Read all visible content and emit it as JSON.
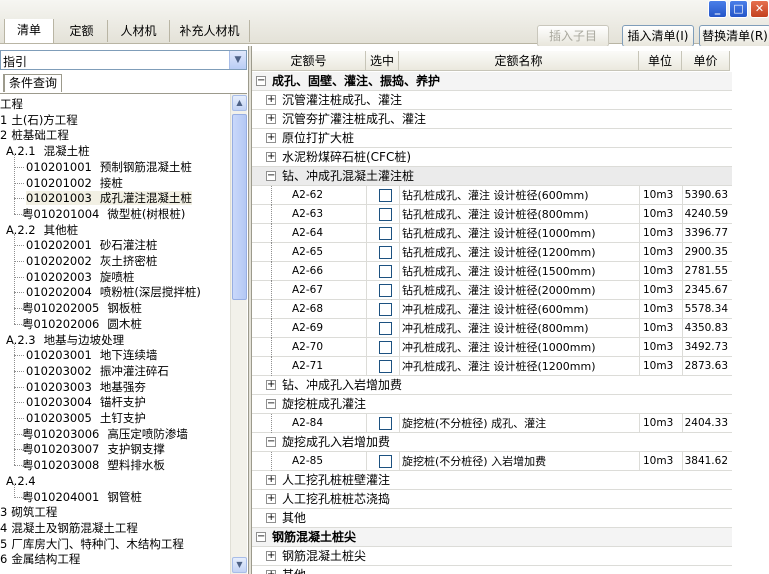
{
  "window": {
    "minimize": "_",
    "maximize": "□",
    "close": "✕"
  },
  "tabs": [
    {
      "label": "清单"
    },
    {
      "label": "定额"
    },
    {
      "label": "人材机"
    },
    {
      "label": "补充人材机"
    }
  ],
  "toolbar": {
    "insert_child": "插入子目",
    "insert_list": "插入清单(I)",
    "replace_list": "替换清单(R)"
  },
  "left": {
    "combo_value": "指引",
    "search_tab": "条件查询",
    "tree": [
      {
        "code": "工程",
        "name": ""
      },
      {
        "code": "1",
        "name": "土(石)方工程"
      },
      {
        "code": "2",
        "name": "桩基础工程"
      },
      {
        "code": "A.2.1",
        "name": "混凝土桩"
      },
      {
        "code": "010201001",
        "name": "预制钢筋混凝土桩"
      },
      {
        "code": "010201002",
        "name": "接桩"
      },
      {
        "code": "010201003",
        "name": "成孔灌注混凝土桩"
      },
      {
        "code": "粤010201004",
        "name": "微型桩(树根桩)"
      },
      {
        "code": "A.2.2",
        "name": "其他桩"
      },
      {
        "code": "010202001",
        "name": "砂石灌注桩"
      },
      {
        "code": "010202002",
        "name": "灰土挤密桩"
      },
      {
        "code": "010202003",
        "name": "旋喷桩"
      },
      {
        "code": "010202004",
        "name": "喷粉桩(深层搅拌桩)"
      },
      {
        "code": "粤010202005",
        "name": "钢板桩"
      },
      {
        "code": "粤010202006",
        "name": "圆木桩"
      },
      {
        "code": "A.2.3",
        "name": "地基与边坡处理"
      },
      {
        "code": "010203001",
        "name": "地下连续墙"
      },
      {
        "code": "010203002",
        "name": "振冲灌注碎石"
      },
      {
        "code": "010203003",
        "name": "地基强夯"
      },
      {
        "code": "010203004",
        "name": "锚杆支护"
      },
      {
        "code": "010203005",
        "name": "土钉支护"
      },
      {
        "code": "粤010203006",
        "name": "高压定喷防渗墙"
      },
      {
        "code": "粤010203007",
        "name": "支护钢支撑"
      },
      {
        "code": "粤010203008",
        "name": "塑料排水板"
      },
      {
        "code": "A.2.4",
        "name": ""
      },
      {
        "code": "粤010204001",
        "name": "钢管桩"
      },
      {
        "code": "3",
        "name": "砌筑工程"
      },
      {
        "code": "4",
        "name": "混凝土及钢筋混凝土工程"
      },
      {
        "code": "5",
        "name": "厂库房大门、特种门、木结构工程"
      },
      {
        "code": "6",
        "name": "金属结构工程"
      }
    ],
    "scroll_up": "▲",
    "scroll_down": "▼"
  },
  "grid": {
    "headers": {
      "code": "定额号",
      "select": "选中",
      "name": "定额名称",
      "unit": "单位",
      "price": "单价"
    },
    "rows": [
      {
        "kind": "group",
        "marker": "−",
        "text": "成孔、固壁、灌注、振捣、养护"
      },
      {
        "kind": "sub",
        "marker": "+",
        "text": "沉管灌注桩成孔、灌注"
      },
      {
        "kind": "sub",
        "marker": "+",
        "text": "沉管夯扩灌注桩成孔、灌注"
      },
      {
        "kind": "sub",
        "marker": "+",
        "text": "原位打扩大桩"
      },
      {
        "kind": "sub",
        "marker": "+",
        "text": "水泥粉煤碎石桩(CFC桩)"
      },
      {
        "kind": "sub",
        "marker": "−",
        "text": "钻、冲成孔混凝土灌注桩"
      },
      {
        "kind": "item",
        "code": "A2-62",
        "name": "钻孔桩成孔、灌注 设计桩径(600mm)",
        "unit": "10m3",
        "price": "5390.63"
      },
      {
        "kind": "item",
        "code": "A2-63",
        "name": "钻孔桩成孔、灌注 设计桩径(800mm)",
        "unit": "10m3",
        "price": "4240.59"
      },
      {
        "kind": "item",
        "code": "A2-64",
        "name": "钻孔桩成孔、灌注 设计桩径(1000mm)",
        "unit": "10m3",
        "price": "3396.77"
      },
      {
        "kind": "item",
        "code": "A2-65",
        "name": "钻孔桩成孔、灌注 设计桩径(1200mm)",
        "unit": "10m3",
        "price": "2900.35"
      },
      {
        "kind": "item",
        "code": "A2-66",
        "name": "钻孔桩成孔、灌注 设计桩径(1500mm)",
        "unit": "10m3",
        "price": "2781.55"
      },
      {
        "kind": "item",
        "code": "A2-67",
        "name": "钻孔桩成孔、灌注 设计桩径(2000mm)",
        "unit": "10m3",
        "price": "2345.67"
      },
      {
        "kind": "item",
        "code": "A2-68",
        "name": "冲孔桩成孔、灌注 设计桩径(600mm)",
        "unit": "10m3",
        "price": "5578.34"
      },
      {
        "kind": "item",
        "code": "A2-69",
        "name": "冲孔桩成孔、灌注 设计桩径(800mm)",
        "unit": "10m3",
        "price": "4350.83"
      },
      {
        "kind": "item",
        "code": "A2-70",
        "name": "冲孔桩成孔、灌注 设计桩径(1000mm)",
        "unit": "10m3",
        "price": "3492.73"
      },
      {
        "kind": "item",
        "code": "A2-71",
        "name": "冲孔桩成孔、灌注 设计桩径(1200mm)",
        "unit": "10m3",
        "price": "2873.63"
      },
      {
        "kind": "sub",
        "marker": "+",
        "text": "钻、冲成孔入岩增加费"
      },
      {
        "kind": "sub",
        "marker": "−",
        "text": "旋挖桩成孔灌注"
      },
      {
        "kind": "item",
        "code": "A2-84",
        "name": "旋挖桩(不分桩径) 成孔、灌注",
        "unit": "10m3",
        "price": "2404.33"
      },
      {
        "kind": "sub",
        "marker": "−",
        "text": "旋挖成孔入岩增加费"
      },
      {
        "kind": "item",
        "code": "A2-85",
        "name": "旋挖桩(不分桩径) 入岩增加费",
        "unit": "10m3",
        "price": "3841.62"
      },
      {
        "kind": "sub",
        "marker": "+",
        "text": "人工挖孔桩桩壁灌注"
      },
      {
        "kind": "sub",
        "marker": "+",
        "text": "人工挖孔桩桩芯浇捣"
      },
      {
        "kind": "sub",
        "marker": "+",
        "text": "其他"
      },
      {
        "kind": "group",
        "marker": "−",
        "text": "钢筋混凝土桩尖"
      },
      {
        "kind": "sub",
        "marker": "+",
        "text": "钢筋混凝土桩尖"
      },
      {
        "kind": "sub",
        "marker": "+",
        "text": "其他"
      }
    ]
  }
}
